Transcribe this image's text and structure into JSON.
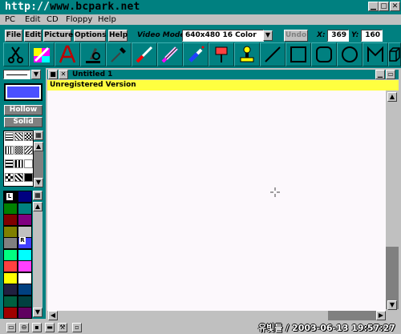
{
  "app": {
    "watermark": "http://www.bcpark.net",
    "watermark_prefix": "http://",
    "watermark_rest": "www.bcpark.net"
  },
  "menu": [
    "PC",
    "Edit",
    "CD",
    "Floppy",
    "Help"
  ],
  "toolbar": {
    "buttons": [
      "File",
      "Edit",
      "Picture",
      "Options",
      "Help"
    ],
    "video_mode_label": "Video Mode:",
    "video_mode_value": "640x480 16 Color",
    "undo_label": "Undo",
    "x_label": "X:",
    "x_value": "369",
    "y_label": "Y:",
    "y_value": "160"
  },
  "tools": [
    "scissors",
    "eraser",
    "text",
    "microscope",
    "dropper",
    "paint-brush",
    "marker",
    "spray",
    "roller",
    "stamp",
    "line",
    "rectangle",
    "rounded-rectangle",
    "circle",
    "polygon",
    "cube"
  ],
  "left": {
    "hollow_label": "Hollow",
    "solid_label": "Solid",
    "current_color": "#4a50ff",
    "l_label": "L",
    "r_label": "R"
  },
  "document": {
    "title": "Untitled 1",
    "banner": "Unregistered Version"
  },
  "palette": [
    [
      "#000000",
      "#000080"
    ],
    [
      "#008000",
      "#008080"
    ],
    [
      "#800000",
      "#800080"
    ],
    [
      "#808000",
      "#c0c0c0"
    ],
    [
      "#808080",
      "#4040ff"
    ],
    [
      "#00ff80",
      "#00ffff"
    ],
    [
      "#ff4040",
      "#ff40ff"
    ],
    [
      "#ffff00",
      "#ffffff"
    ],
    [
      "#202040",
      "#004080"
    ],
    [
      "#006040",
      "#004040"
    ],
    [
      "#a00000",
      "#600060"
    ]
  ],
  "status": {
    "timestamp": "유빛들 / 2003-06-13 19:57:27"
  }
}
